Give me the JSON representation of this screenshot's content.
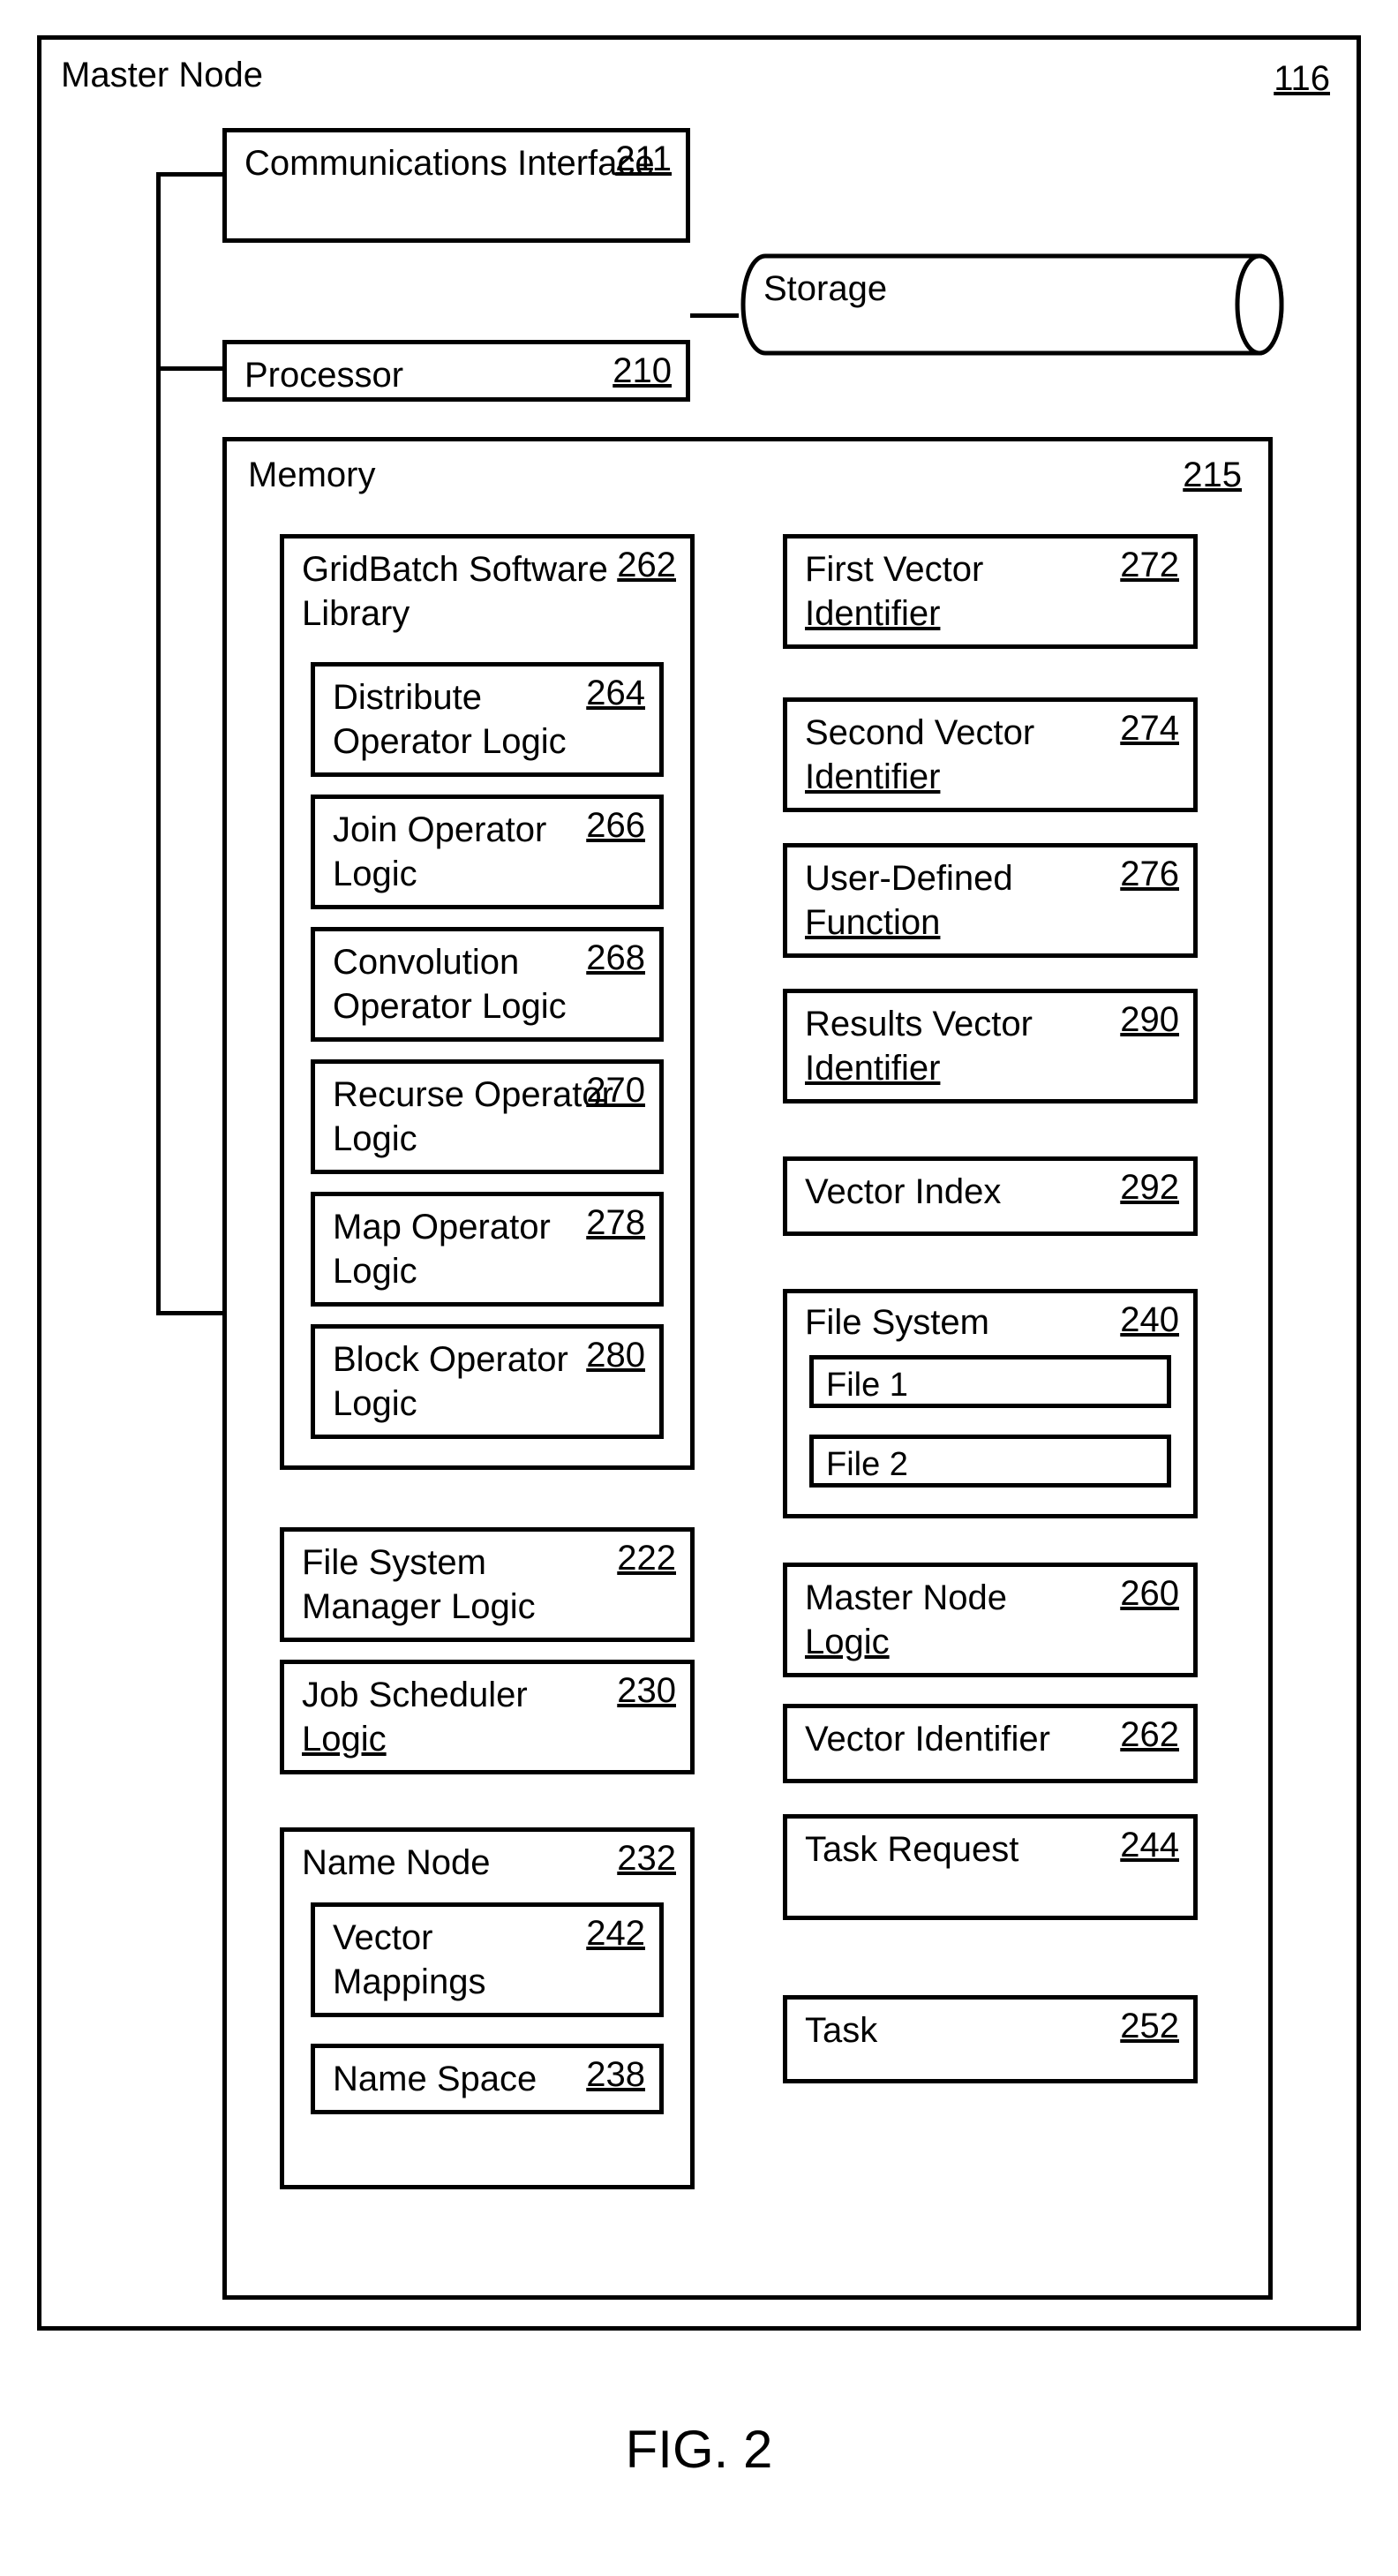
{
  "outer": {
    "title": "Master Node",
    "ref": "116"
  },
  "comm": {
    "label": "Communications Interface",
    "ref": "211"
  },
  "proc": {
    "label": "Processor",
    "ref": "210"
  },
  "storage": {
    "label": "Storage"
  },
  "memory": {
    "label": "Memory",
    "ref": "215"
  },
  "library": {
    "label": "GridBatch Software Library",
    "ref": "262"
  },
  "dist": {
    "label": "Distribute Operator Logic",
    "ref": "264"
  },
  "join": {
    "label": "Join Operator Logic",
    "ref": "266"
  },
  "conv": {
    "label": "Convolution Operator Logic",
    "ref": "268"
  },
  "recurse": {
    "label": "Recurse Operator Logic",
    "ref": "270"
  },
  "map": {
    "label": "Map Operator Logic",
    "ref": "278"
  },
  "block": {
    "label": "Block Operator Logic",
    "ref": "280"
  },
  "fsm": {
    "label": "File System Manager Logic",
    "ref": "222"
  },
  "jobsched": {
    "label_a": "Job Scheduler",
    "label_b": "Logic",
    "ref": "230"
  },
  "namenode": {
    "label": "Name Node",
    "ref": "232"
  },
  "vecmap": {
    "label": "Vector Mappings",
    "ref": "242"
  },
  "namespace": {
    "label": "Name Space",
    "ref": "238"
  },
  "fv": {
    "label_a": "First Vector",
    "label_b": "Identifier",
    "ref": "272"
  },
  "sv": {
    "label_a": "Second Vector",
    "label_b": "Identifier",
    "ref": "274"
  },
  "udf": {
    "label_a": "User-Defined",
    "label_b": "Function",
    "ref": "276"
  },
  "rv": {
    "label_a": "Results Vector",
    "label_b": "Identifier",
    "ref": "290"
  },
  "vidx": {
    "label": "Vector Index",
    "ref": "292"
  },
  "fs": {
    "label": "File System",
    "ref": "240",
    "file1": "File 1",
    "file2": "File 2"
  },
  "mnl": {
    "label_a": "Master Node",
    "label_b": "Logic",
    "ref": "260"
  },
  "vid": {
    "label": "Vector Identifier",
    "ref": "262"
  },
  "treq": {
    "label": "Task Request",
    "ref": "244"
  },
  "task": {
    "label": "Task",
    "ref": "252"
  },
  "fig": "FIG. 2"
}
